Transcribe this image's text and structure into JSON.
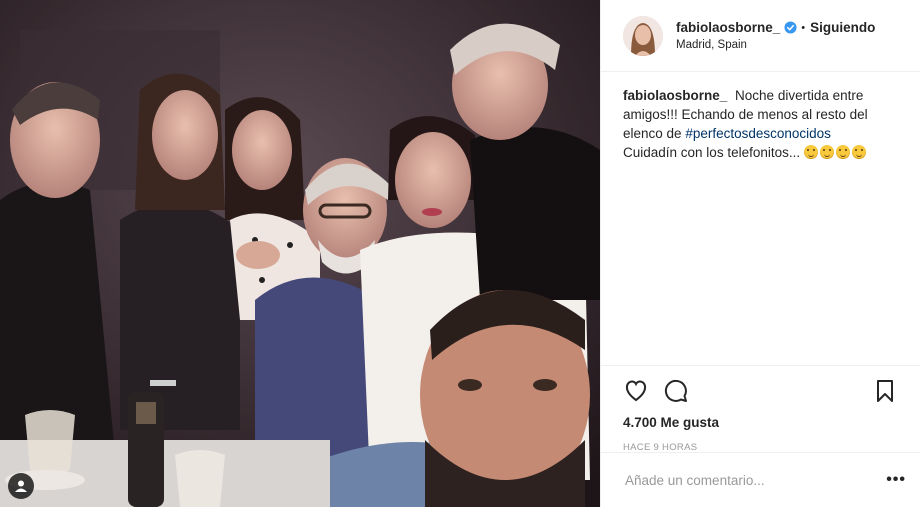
{
  "post": {
    "photo": {
      "alt_icon": "user-tag-icon"
    },
    "header": {
      "username": "fabiolaosborne_",
      "verified": true,
      "separator": "•",
      "follow_label": "Siguiendo",
      "location": "Madrid, Spain"
    },
    "caption": {
      "username": "fabiolaosborne_",
      "text_1": "Noche divertida entre amigos!!! Echando de menos al resto del elenco de ",
      "hashtag": "#perfectosdesconocidos",
      "text_2": "Cuidadín con los telefonitos... ",
      "emojis": [
        "wink-emoji",
        "laughing-emoji",
        "laughing-emoji",
        "laughing-emoji"
      ]
    },
    "actions": {
      "like_icon": "heart-icon",
      "comment_icon": "comment-icon",
      "save_icon": "bookmark-icon",
      "likes": "4.700 Me gusta",
      "time": "HACE 9 HORAS"
    },
    "comment": {
      "placeholder": "Añade un comentario...",
      "more_label": "•••"
    },
    "colors": {
      "verified": "#3897f0",
      "hashtag": "#003569",
      "border": "#efefef",
      "muted": "#999999"
    }
  }
}
